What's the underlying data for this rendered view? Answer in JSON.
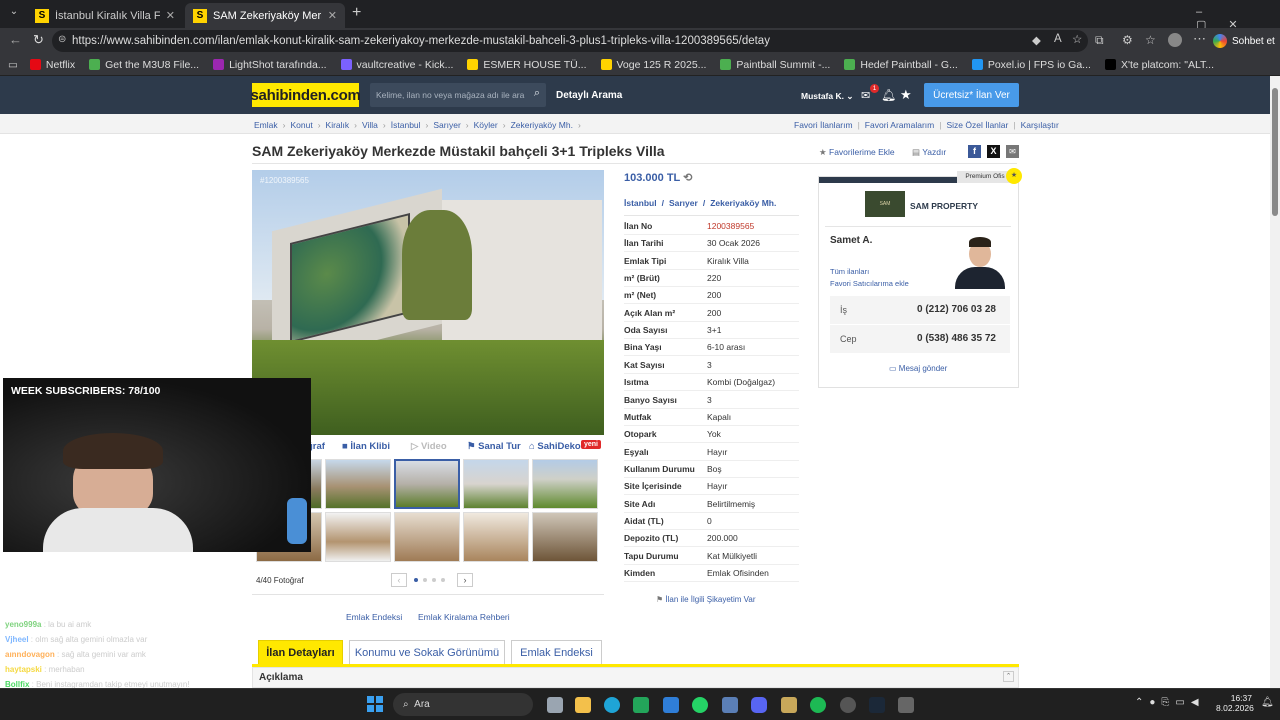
{
  "browser": {
    "tabs": [
      {
        "title": "İstanbul Kiralık Villa Fiyatları sahibi",
        "active": false
      },
      {
        "title": "SAM Zekeriyaköy Merkezde Müstakil",
        "active": true
      }
    ],
    "new_tab": "+",
    "url": "https://www.sahibinden.com/ilan/emlak-konut-kiralik-sam-zekeriyakoy-merkezde-mustakil-bahceli-3-plus1-tripleks-villa-1200389565/detay",
    "profile_label": "Sohbet et",
    "bookmarks": [
      {
        "label": "Netflix",
        "color": "#e50914"
      },
      {
        "label": "Get the M3U8 File...",
        "color": "#4caf50"
      },
      {
        "label": "LightShot tarafında...",
        "color": "#9c27b0"
      },
      {
        "label": "vaultcreative - Kick...",
        "color": "#7b61ff"
      },
      {
        "label": "ESMER HOUSE TÜ...",
        "color": "#ffd300"
      },
      {
        "label": "Voge 125 R 2025...",
        "color": "#ffd300"
      },
      {
        "label": "Paintball Summit -...",
        "color": "#4caf50"
      },
      {
        "label": "Hedef Paintball - G...",
        "color": "#4caf50"
      },
      {
        "label": "Poxel.io | FPS io Ga...",
        "color": "#2196f3"
      },
      {
        "label": "X'te platcom: \"ALT...",
        "color": "#000000"
      }
    ]
  },
  "site": {
    "logo": "sahibinden.com",
    "search_placeholder": "Kelime, ilan no veya mağaza adı ile ara",
    "detailed_search": "Detaylı Arama",
    "user": "Mustafa K.",
    "notif_count": "1",
    "post_ad": "Ücretsiz* İlan Ver",
    "breadcrumbs": [
      "Emlak",
      "Konut",
      "Kiralık",
      "Villa",
      "İstanbul",
      "Sarıyer",
      "Köyler",
      "Zekeriyaköy Mh."
    ],
    "right_links": [
      "Favori İlanlarım",
      "Favori Aramalarım",
      "Size Özel İlanlar",
      "Karşılaştır"
    ]
  },
  "listing": {
    "title": "SAM Zekeriyaköy Merkezde Müstakil bahçeli 3+1 Tripleks Villa",
    "add_favorite": "Favorilerime Ekle",
    "print": "Yazdır",
    "price": "103.000 TL",
    "location": [
      "İstanbul",
      "Sarıyer",
      "Zekeriyaköy Mh."
    ],
    "watermark_no": "#1200389565",
    "details": [
      {
        "k": "İlan No",
        "v": "1200389565"
      },
      {
        "k": "İlan Tarihi",
        "v": "30 Ocak 2026"
      },
      {
        "k": "Emlak Tipi",
        "v": "Kiralık Villa"
      },
      {
        "k": "m² (Brüt)",
        "v": "220"
      },
      {
        "k": "m² (Net)",
        "v": "200"
      },
      {
        "k": "Açık Alan m²",
        "v": "200"
      },
      {
        "k": "Oda Sayısı",
        "v": "3+1"
      },
      {
        "k": "Bina Yaşı",
        "v": "6-10 arası"
      },
      {
        "k": "Kat Sayısı",
        "v": "3"
      },
      {
        "k": "Isıtma",
        "v": "Kombi (Doğalgaz)"
      },
      {
        "k": "Banyo Sayısı",
        "v": "3"
      },
      {
        "k": "Mutfak",
        "v": "Kapalı"
      },
      {
        "k": "Otopark",
        "v": "Yok"
      },
      {
        "k": "Eşyalı",
        "v": "Hayır"
      },
      {
        "k": "Kullanım Durumu",
        "v": "Boş"
      },
      {
        "k": "Site İçerisinde",
        "v": "Hayır"
      },
      {
        "k": "Site Adı",
        "v": "Belirtilmemiş"
      },
      {
        "k": "Aidat (TL)",
        "v": "0"
      },
      {
        "k": "Depozito (TL)",
        "v": "200.000"
      },
      {
        "k": "Tapu Durumu",
        "v": "Kat Mülkiyetli"
      },
      {
        "k": "Kimden",
        "v": "Emlak Ofisinden"
      }
    ],
    "complaint": "İlan ile İlgili Şikayetim Var",
    "gallery_tabs": [
      "ğraf",
      "İlan Klibi",
      "Video",
      "Sanal Tur",
      "SahiDeko"
    ],
    "new_badge": "yeni",
    "photo_count": "4/40 Fotoğraf",
    "below_links": [
      "Emlak Endeksi",
      "Emlak Kiralama Rehberi"
    ],
    "section_tabs": [
      "İlan Detayları",
      "Konumu ve Sokak Görünümü",
      "Emlak Endeksi"
    ],
    "description_header": "Açıklama"
  },
  "seller": {
    "premium": "Premium Ofis",
    "office": "SAM PROPERTY",
    "name": "Samet A.",
    "all_ads": "Tüm ilanları",
    "add_fav_seller": "Favori Satıcılarıma ekle",
    "phones": [
      {
        "k": "İş",
        "v": "0 (212) 706 03 28"
      },
      {
        "k": "Cep",
        "v": "0 (538) 486 35 72"
      }
    ],
    "message": "Mesaj gönder"
  },
  "stream": {
    "subs": "WEEK SUBSCRIBERS: 78/100",
    "chat": [
      {
        "user": "yeno999a",
        "msg": "la bu ai amk",
        "color": "#7fd37f"
      },
      {
        "user": "Vjheel",
        "msg": "olm sağ alta gemini olmazla var",
        "color": "#7fb7ff"
      },
      {
        "user": "aınndovagon",
        "msg": "sağ alta gemini var amk",
        "color": "#ffb15a"
      },
      {
        "user": "haytapski",
        "msg": "merhaban",
        "color": "#f5d942"
      },
      {
        "user": "Bollfix",
        "msg": "Beni instagramdan takip etmeyi unutmayın!",
        "color": "#4cd964"
      },
      {
        "user": "",
        "msg": "http://www.instagram.com/vault.creative/",
        "color": "#ffffff"
      },
      {
        "user": "",
        "msg": "rwnk ayardır ai olan bence",
        "color": "#ff6b6b"
      }
    ]
  },
  "taskbar": {
    "search": "Ara",
    "time": "16:37",
    "date": "8.02.2026"
  }
}
